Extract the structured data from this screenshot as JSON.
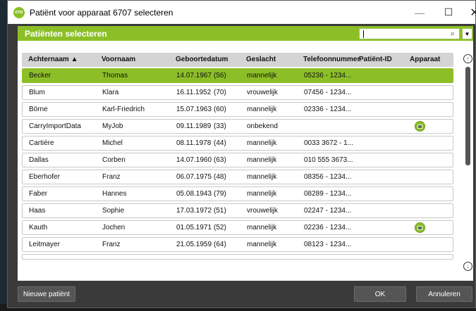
{
  "window": {
    "title": "Patiënt voor apparaat 6707 selecteren",
    "icon_text": "cro",
    "minimize_glyph": "—",
    "maximize_glyph": "☐",
    "close_glyph": "✕"
  },
  "header": {
    "title": "Patiënten selecteren",
    "search_value": "",
    "search_icon_glyph": "⌕",
    "dropdown_glyph": "▼"
  },
  "table": {
    "columns": [
      "Achternaam ▲",
      "Voornaam",
      "Geboortedatum",
      "Geslacht",
      "Telefoonnummer",
      "Patiënt-ID",
      "Apparaat"
    ],
    "rows": [
      {
        "last": "Becker",
        "first": "Thomas",
        "dob": "14.07.1967",
        "age": "(56)",
        "gender": "mannelijk",
        "phone": "05236 - 1234...",
        "pid": "",
        "device": false,
        "selected": true
      },
      {
        "last": "Blum",
        "first": "Klara",
        "dob": "16.11.1952",
        "age": "(70)",
        "gender": "vrouwelijk",
        "phone": "07456 - 1234...",
        "pid": "",
        "device": false,
        "selected": false
      },
      {
        "last": "Börne",
        "first": "Karl-Friedrich",
        "dob": "15.07.1963",
        "age": "(60)",
        "gender": "mannelijk",
        "phone": "02336 - 1234...",
        "pid": "",
        "device": false,
        "selected": false
      },
      {
        "last": "CarryImportData",
        "first": "MyJob",
        "dob": "09.11.1989",
        "age": "(33)",
        "gender": "onbekend",
        "phone": "",
        "pid": "",
        "device": true,
        "selected": false
      },
      {
        "last": "Cartiére",
        "first": "Michel",
        "dob": "08.11.1978",
        "age": "(44)",
        "gender": "mannelijk",
        "phone": "0033 3672 - 1...",
        "pid": "",
        "device": false,
        "selected": false
      },
      {
        "last": "Dallas",
        "first": "Corben",
        "dob": "14.07.1960",
        "age": "(63)",
        "gender": "mannelijk",
        "phone": "010 555 3673...",
        "pid": "",
        "device": false,
        "selected": false
      },
      {
        "last": "Eberhofer",
        "first": "Franz",
        "dob": "06.07.1975",
        "age": "(48)",
        "gender": "mannelijk",
        "phone": "08356 - 1234...",
        "pid": "",
        "device": false,
        "selected": false
      },
      {
        "last": "Faber",
        "first": "Hannes",
        "dob": "05.08.1943",
        "age": "(79)",
        "gender": "mannelijk",
        "phone": "08289 - 1234...",
        "pid": "",
        "device": false,
        "selected": false
      },
      {
        "last": "Haas",
        "first": "Sophie",
        "dob": "17.03.1972",
        "age": "(51)",
        "gender": "vrouwelijk",
        "phone": "02247 - 1234...",
        "pid": "",
        "device": false,
        "selected": false
      },
      {
        "last": "Kauth",
        "first": "Jochen",
        "dob": "01.05.1971",
        "age": "(52)",
        "gender": "mannelijk",
        "phone": "02236 - 1234...",
        "pid": "",
        "device": true,
        "selected": false
      },
      {
        "last": "Leitmayer",
        "first": "Franz",
        "dob": "21.05.1959",
        "age": "(64)",
        "gender": "mannelijk",
        "phone": "08123 - 1234...",
        "pid": "",
        "device": false,
        "selected": false
      }
    ],
    "scroll_up_glyph": "↑",
    "scroll_down_glyph": "↓"
  },
  "footer": {
    "new_patient": "Nieuwe patiënt",
    "ok": "OK",
    "cancel": "Annuleren"
  },
  "colors": {
    "accent": "#8cbf27",
    "selected_row": "#8cbf27",
    "footer_bg": "#3a3a3a"
  }
}
